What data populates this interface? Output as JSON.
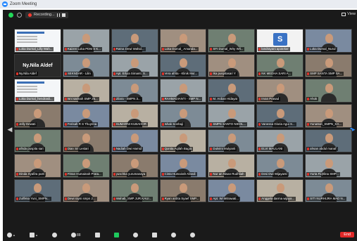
{
  "window": {
    "title": "Zoom Meeting"
  },
  "topbar": {
    "recording_label": "Recording...",
    "view_label": "View"
  },
  "participants": [
    {
      "name": "Loka Durnal_Lilly Wah...",
      "muted": true,
      "kind": "slide"
    },
    {
      "name": "Kaizen Loka PDM S K...",
      "muted": true,
      "kind": "cam"
    },
    {
      "name": "Ratna Dewi Wahid...",
      "muted": true,
      "kind": "cam"
    },
    {
      "name": "Loka Dumal_ Amanda...",
      "muted": true,
      "kind": "cam"
    },
    {
      "name": "SFI Dumal_Wiry Wil...",
      "muted": true,
      "kind": "cam"
    },
    {
      "name": "landrayani apoteker",
      "muted": true,
      "kind": "initial",
      "initial": "S"
    },
    {
      "name": "Loka Dumal_Nurul",
      "muted": true,
      "kind": "cam"
    },
    {
      "name": "Ny.Nila Aldef",
      "muted": true,
      "kind": "name",
      "big": "Ny.Nila Aldef"
    },
    {
      "name": "SEKNDAR - Lilin",
      "muted": true,
      "kind": "cam"
    },
    {
      "name": "Apt. Erlyia Simanti, S...",
      "muted": true,
      "kind": "cam"
    },
    {
      "name": "Vera afrita - Klinik Mut...",
      "muted": true,
      "kind": "cam"
    },
    {
      "name": "Ika puspitasari Y",
      "muted": true,
      "kind": "cam"
    },
    {
      "name": "NK MEDHA SARI A...",
      "muted": true,
      "kind": "cam"
    },
    {
      "name": "SMP SANTA SMP SA...",
      "muted": true,
      "kind": "cam"
    },
    {
      "name": "Loka Durnal_hendrasli...",
      "muted": true,
      "kind": "slide"
    },
    {
      "name": "Isni sarinah SMP 25...",
      "muted": true,
      "kind": "cam"
    },
    {
      "name": "Zilara - SMPN 3...",
      "muted": true,
      "kind": "cam"
    },
    {
      "name": "RAHMADIANTI - SMP N...",
      "muted": true,
      "kind": "cam"
    },
    {
      "name": "M. Ardian Hidayat",
      "muted": true,
      "kind": "cam"
    },
    {
      "name": "Irvan Prasad",
      "muted": true,
      "kind": "cam"
    },
    {
      "name": "Ahok",
      "muted": true,
      "kind": "cam"
    },
    {
      "name": "Jelly Dewati",
      "muted": true,
      "kind": "cam"
    },
    {
      "name": "Ferisah R S Thuyrina",
      "muted": true,
      "kind": "cam"
    },
    {
      "name": "SUMARNI KUBAHOR",
      "muted": true,
      "kind": "cam"
    },
    {
      "name": "Ishak Sonhaji",
      "muted": true,
      "kind": "cam"
    },
    {
      "name": "SMPS SANTO NIKOL...",
      "muted": true,
      "kind": "cam"
    },
    {
      "name": "Vanessa Gloria Agui S...",
      "muted": true,
      "kind": "cam"
    },
    {
      "name": "YunaSari_SMPN_KA...",
      "muted": true,
      "kind": "cam"
    },
    {
      "name": "afrida puspita sari",
      "muted": true,
      "kind": "cam"
    },
    {
      "name": "Dian Sri Lestari",
      "muted": true,
      "kind": "cam"
    },
    {
      "name": "Nadiah Dwi Hamid",
      "muted": true,
      "kind": "cam"
    },
    {
      "name": "Qonita Aqilah Bagia",
      "muted": true,
      "kind": "cam"
    },
    {
      "name": "Dulvimi Mulyanti",
      "muted": true,
      "kind": "cam"
    },
    {
      "name": "ELVI MAULANI",
      "muted": true,
      "kind": "cam"
    },
    {
      "name": "ahsan abdul manaf",
      "muted": true,
      "kind": "cam"
    },
    {
      "name": "Dinda Syafira putri",
      "muted": true,
      "kind": "cam"
    },
    {
      "name": "Fitran Humainah Prata...",
      "muted": true,
      "kind": "cam"
    },
    {
      "name": "yuschka yurumanaya",
      "muted": true,
      "kind": "cam"
    },
    {
      "name": "Cinta Humairah Afandi",
      "muted": true,
      "kind": "cam"
    },
    {
      "name": "Nur an Nisan Rudhliah",
      "muted": true,
      "kind": "cam"
    },
    {
      "name": "Desi Dwi Wijayanti",
      "muted": true,
      "kind": "cam"
    },
    {
      "name": "Yurta Fiqhlina SMP...",
      "muted": true,
      "kind": "cam"
    },
    {
      "name": "Zulfikka Yuni_SMPN...",
      "muted": true,
      "kind": "cam"
    },
    {
      "name": "Dewi rayni smpn 2...",
      "muted": true,
      "kind": "cam"
    },
    {
      "name": "Wahab_SMP JUR.KAUI...",
      "muted": true,
      "kind": "cam"
    },
    {
      "name": "Ryan ardita Syaef SMP...",
      "muted": true,
      "kind": "cam"
    },
    {
      "name": "Apt. Wi Mitrawati...",
      "muted": true,
      "kind": "cam"
    },
    {
      "name": "Anggela darma wijaya...",
      "muted": true,
      "kind": "cam"
    },
    {
      "name": "SITI NURHIJRA MAD N...",
      "muted": true,
      "kind": "cam"
    }
  ],
  "toolbar": {
    "participants_count": "88",
    "end_label": "End"
  },
  "colors": {
    "accent": "#2d8cff",
    "end_button": "#e02828",
    "recording": "#ff3b30",
    "shield": "#23d959"
  }
}
